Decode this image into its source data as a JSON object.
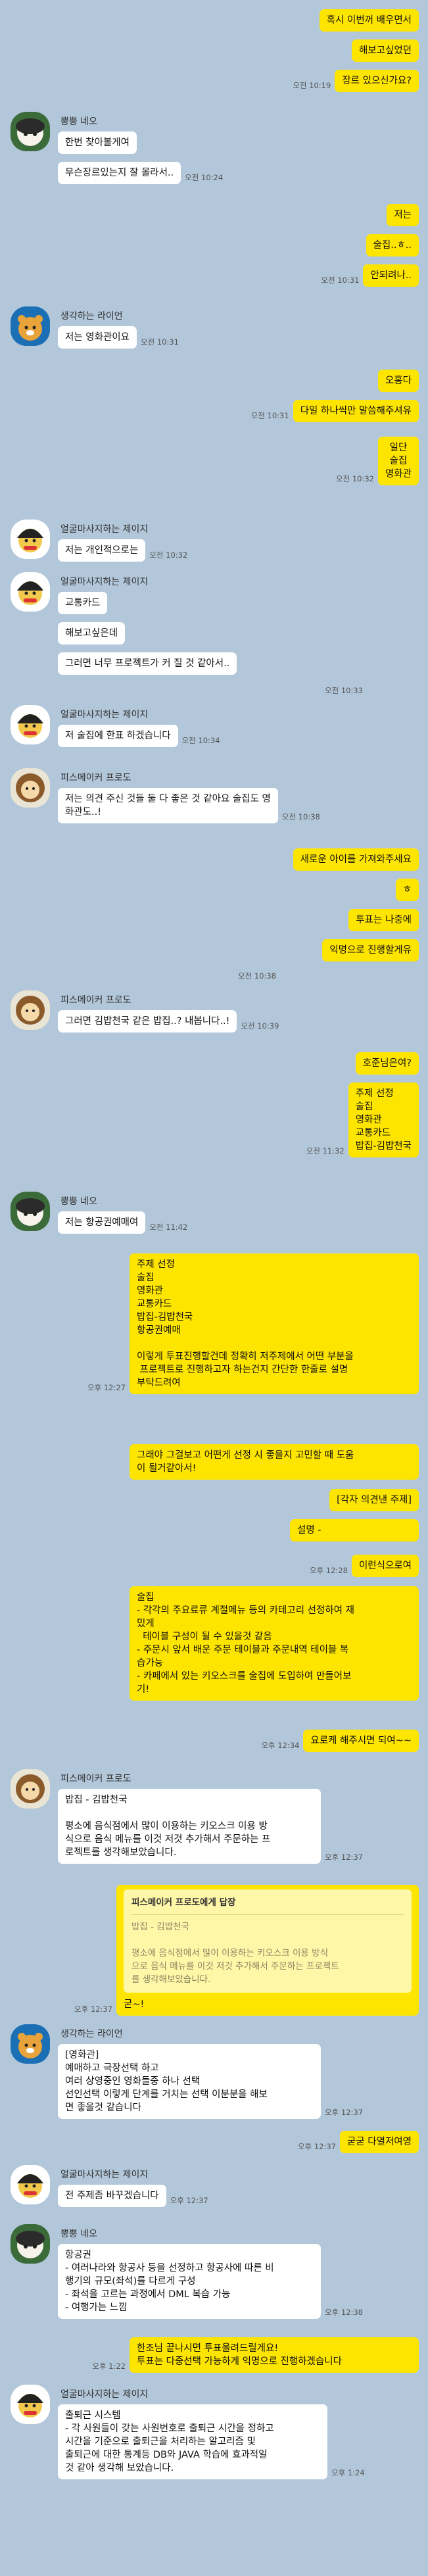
{
  "messages": {
    "m1": "혹시 이번꺼 배우면서",
    "m2": "해보고싶었던",
    "m3": "장르 있으신가요?",
    "t1": "오전 10:19",
    "s_bb": "뿡뿡 네오",
    "m4": "한번 찾아볼게여",
    "m5": "무슨장르있는지 잘 몰라서..",
    "t2": "오전 10:24",
    "m6": "저는",
    "m7": "술집..ㅎ..",
    "m8": "안되려나..",
    "t3": "오전 10:31",
    "s_lion": "생각하는 라이언",
    "m9": "저는 영화관이요",
    "t4": "오전 10:31",
    "m10": "오홍다",
    "m11": "다일 하나씩만 말씀해주셔유",
    "t5": "오전 10:31",
    "m12": "일단\n술집\n영화관",
    "t6": "오전 10:32",
    "s_jay": "얼굴마사지하는 제이지",
    "m13": "저는 개인적으로는",
    "t7": "오전 10:32",
    "m14": "교통카드",
    "m15": "해보고싶은데",
    "m16": "그러면 너무 프로젝트가 커 질 것 같아서..",
    "t8": "오전 10:33",
    "m17": "저 술집에 한표 하겠습니다",
    "t9": "오전 10:34",
    "s_frodo": "피스메이커 프로도",
    "m18": "저는 의견 주신 것들 둘 다 좋은 것 같아요 술집도 영\n화관도..!",
    "t10": "오전 10:38",
    "m19": "새로운 아이를 가져와주세요",
    "m20": "ㅎ",
    "m21": "투표는 나중에",
    "m22": "익명으로 진행할게유",
    "t11": "오전 10:38",
    "m23": "그러면 김밥천국 같은 밥집..? 내봅니다..!",
    "t12": "오전 10:39",
    "m24": "호준님은여?",
    "m25": "주제 선정\n술집\n영화관\n교통카드\n밥집-김밥천국",
    "t13": "오전 11:32",
    "m26": "저는 항공권예매여",
    "t14": "오전 11:42",
    "m27": "주제 선정\n술집\n영화관\n교통카드\n밥집-김밥천국\n항공권예매\n\n이렇게 투표진행할건데 정확히 저주제에서 어떤 부분을\n 프로젝트로 진행하고자 하는건지 간단한 한줄로 설명\n부탁드려여",
    "t15": "오후 12:27",
    "m28": "그래야 그걸보고 어떤게 선정 시 좋을지 고민할 때 도움\n이 될거같아서!",
    "m29": "[각자 의견낸 주제]",
    "m30": "설명 -",
    "t16": "오후 12:28",
    "m31": "이런식으로여",
    "m32": "술집\n- 각각의 주요료류 계절메뉴 등의 카테고리 선정하여 재\n밌게\n  테이블 구성이 될 수 있을것 같음\n- 주문시 앞서 배운 주문 테이블과 주문내역 테이블 복\n습가능\n- 카페에서 있는 키오스크를 술집에 도입하여 만들어보\n기!",
    "t17": "오후 12:34",
    "m33": "요로케 해주시면 되여~~",
    "m34": "밥집 - 김밥천국\n\n평소에 음식점에서 많이 이용하는 키오스크 이용 방\n식으로 음식 메뉴를 이것 저것 추가해서 주문하는 프\n로젝트를 생각해보았습니다.",
    "t18": "오후 12:37",
    "q_title": "피스메이커 프로도에게 답장",
    "q_text": "밥집 - 김밥천국\n\n평소에 음식점에서 많이 이용하는 키오스크 이용 방식\n으로 음식 메뉴를 이것 저것 추가해서 주문하는 프로젝트\n를 생각해보았습니다.",
    "q_reply": "굳~!",
    "t19": "오후 12:37",
    "m35": "[영화관]\n예매하고 극장선택 하고\n여러 상영중인 영화들중 하나 선택\n선인선택 이렇게 단계를 거치는 선택 이분분을 해보\n면 좋을것 같습니다",
    "t20": "오후 12:37",
    "m36": "굳굳 다열저여영",
    "t21": "오후 12:37",
    "m37": "전 주제좀 바꾸겠습니다",
    "t22": "오후 12:37",
    "m38": "항공권\n- 여러나라와 항공사 등을 선정하고 항공사에 따른 비\n행기의 규모(좌석)를 다르게 구성\n- 좌석을 고르는 과정에서 DML 복습 가능\n- 여행가는 느낌",
    "t23": "오후 12:38",
    "m39": "한조님 끝나시면 투표올려드릴게요!\n투표는 다중선택 가능하게 익명으로 진행하겠습니다",
    "t24": "오후 1:22",
    "m40": "출퇴근 시스템\n- 각 사원들이 갖는 사원번호로 출퇴근 시간을 정하고\n시간을 기준으로 출퇴근을 처리하는 알고리즘 및\n출퇴근에 대한 통계등 DB와 JAVA 학습에 효과적일\n것 같아 생각해 보았습니다.",
    "t25": "오후 1:24"
  },
  "colors": {
    "background": "#b2c7da",
    "outgoing_bubble": "#fee500",
    "incoming_bubble": "#ffffff"
  }
}
